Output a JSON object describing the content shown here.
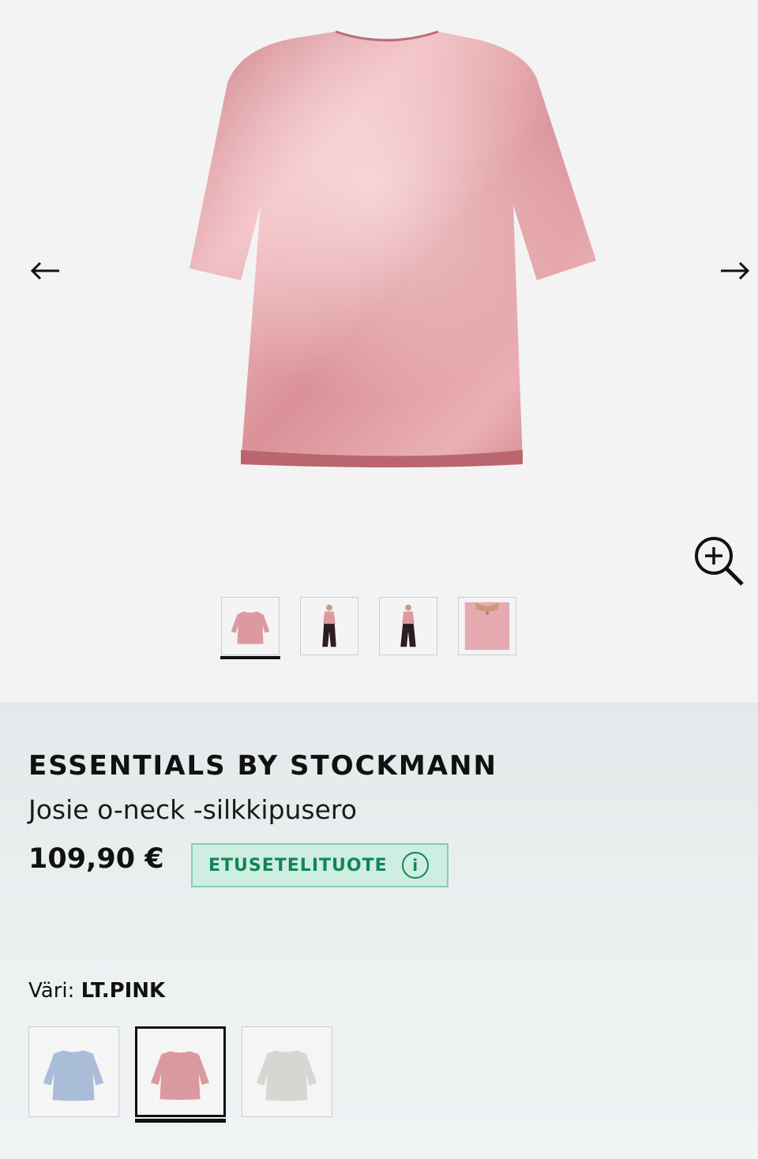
{
  "gallery": {
    "prev_icon": "arrow-left-icon",
    "next_icon": "arrow-right-icon",
    "zoom_icon": "zoom-in-icon",
    "thumbnails": [
      {
        "view": "front-flat",
        "selected": true
      },
      {
        "view": "model-front",
        "selected": false
      },
      {
        "view": "model-front-2",
        "selected": false
      },
      {
        "view": "back-detail",
        "selected": false
      }
    ]
  },
  "product": {
    "brand": "ESSENTIALS BY STOCKMANN",
    "name": "Josie o-neck -silkkipusero",
    "price": "109,90 €",
    "badge": {
      "label": "ETUSETELITUOTE",
      "icon": "info-icon",
      "icon_glyph": "i"
    },
    "color_label": "Väri:",
    "color_value": "LT.PINK",
    "colors": [
      {
        "name": "light blue",
        "hex": "#a9bdd8",
        "selected": false
      },
      {
        "name": "LT.PINK",
        "hex": "#d99a9f",
        "selected": true
      },
      {
        "name": "light grey",
        "hex": "#d5d7d2",
        "selected": false
      }
    ]
  },
  "colors": {
    "accent_green": "#11855a",
    "badge_bg": "#cdeee0",
    "shirt_pink": "#dd9aa0"
  }
}
